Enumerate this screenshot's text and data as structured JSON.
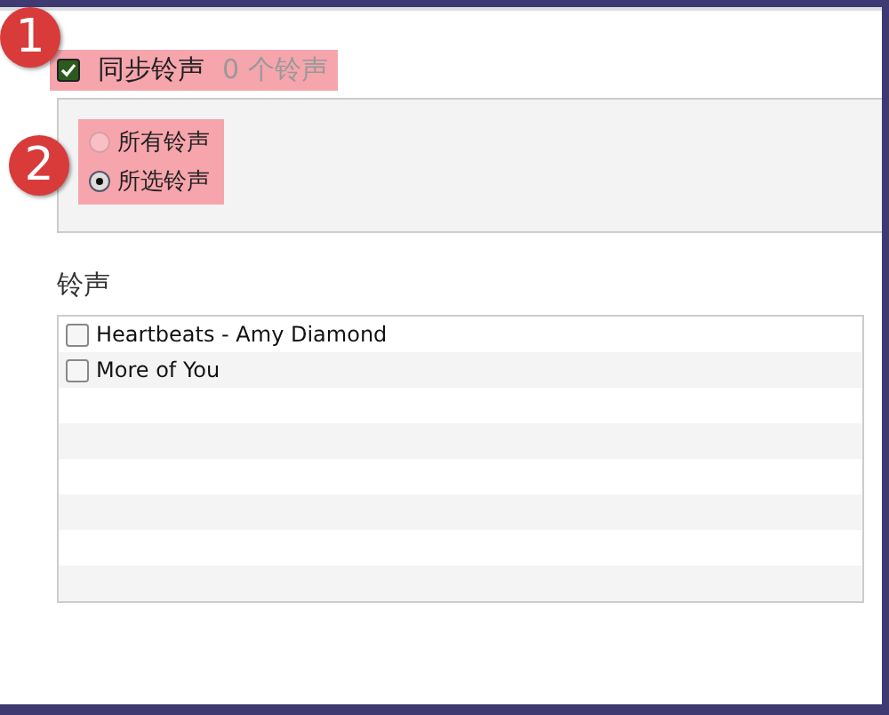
{
  "sync": {
    "label": "同步铃声",
    "count": "0 个铃声",
    "checked": true,
    "callout": "1"
  },
  "options": {
    "callout": "2",
    "radios": [
      {
        "label": "所有铃声",
        "selected": false,
        "disabled": true
      },
      {
        "label": "所选铃声",
        "selected": true,
        "disabled": false
      }
    ]
  },
  "ringtones": {
    "heading": "铃声",
    "rows": [
      {
        "title": "Heartbeats - Amy Diamond",
        "checked": false
      },
      {
        "title": "More of You",
        "checked": false
      }
    ]
  }
}
